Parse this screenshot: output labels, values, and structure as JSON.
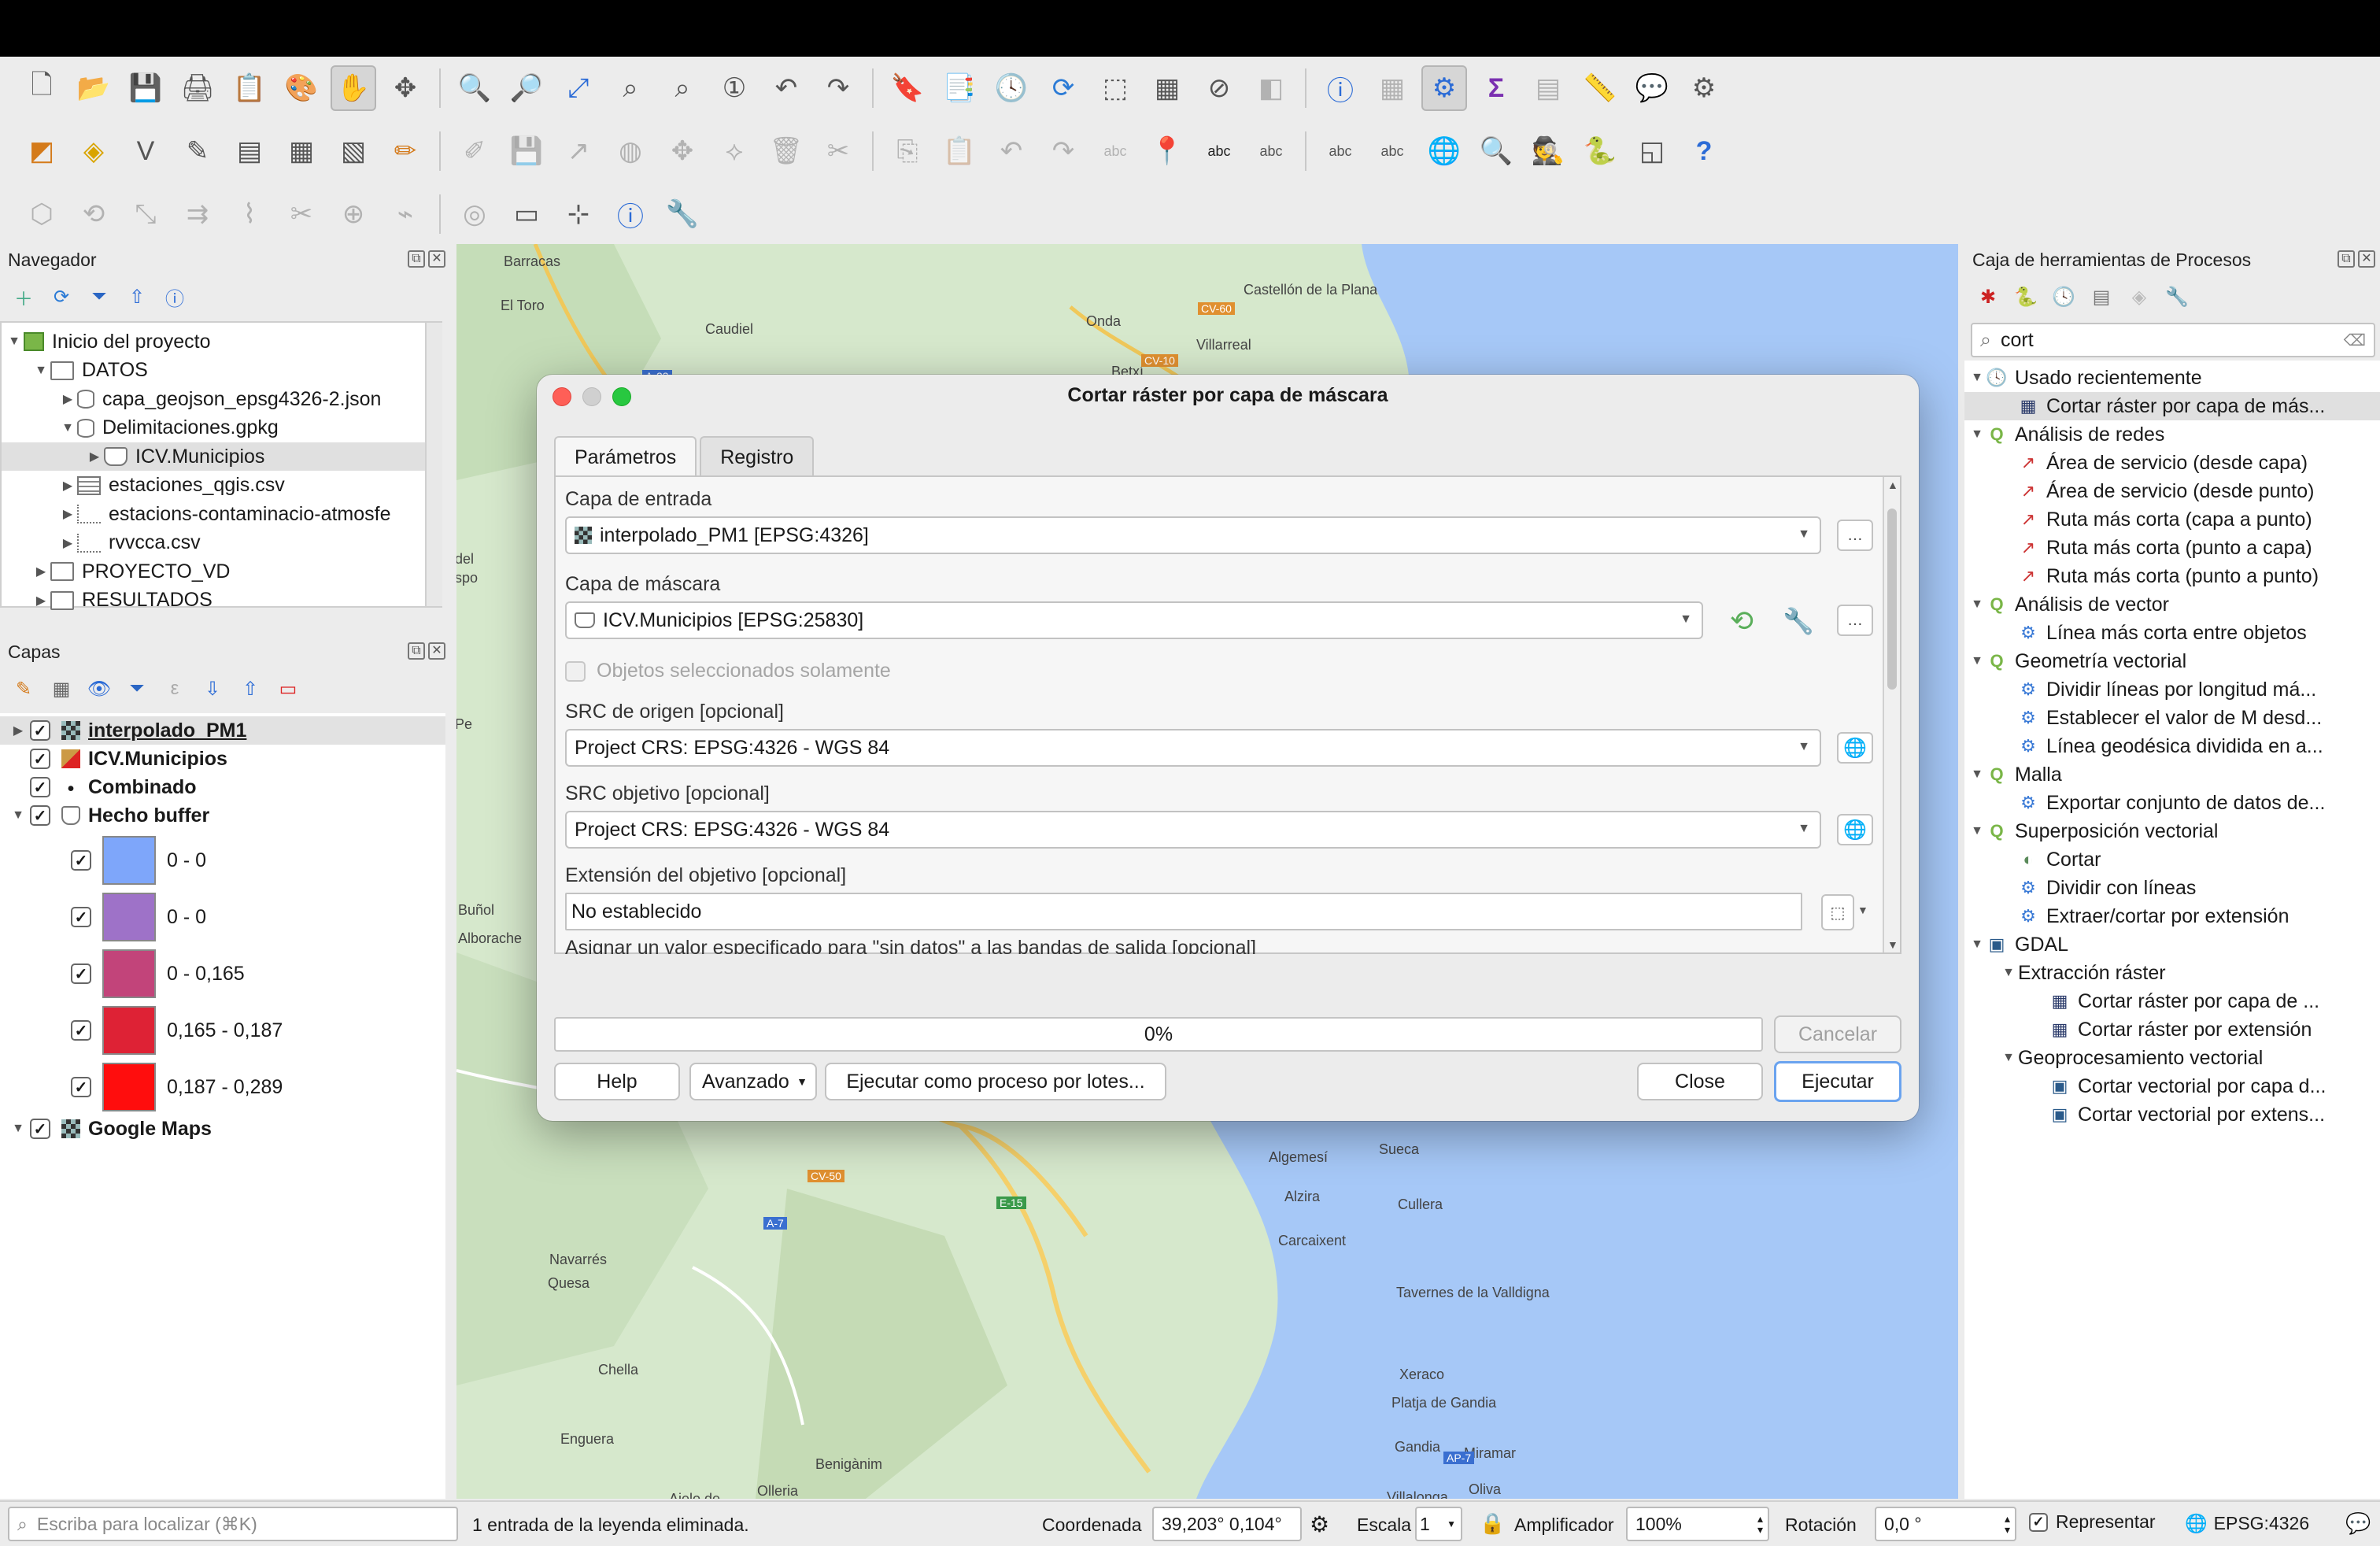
{
  "toolbar_icons": {
    "row1": [
      "new-project",
      "open-project",
      "save-project",
      "new-print-layout",
      "layout-manager",
      "style-manager",
      "pan",
      "pan-to-selection",
      "zoom-in",
      "zoom-out",
      "zoom-full",
      "zoom-to-selection",
      "zoom-to-layer",
      "zoom-native",
      "zoom-last",
      "zoom-next",
      "new-bookmark",
      "show-bookmarks",
      "temporal-controller",
      "refresh",
      "select-features",
      "open-table",
      "deselect",
      "select-by-location",
      "identify",
      "measure-grid",
      "processing-gear",
      "sum",
      "attribute-table",
      "measure-line",
      "annotation",
      "settings"
    ],
    "row2": [
      "data-source-manager",
      "new-geopackage",
      "new-shapefile",
      "new-temp-scratch",
      "add-vector",
      "add-raster",
      "add-mesh",
      "digitize-edit",
      "pencil",
      "save-edits",
      "digitize-line",
      "add-feature",
      "move-feature",
      "vertex-tool",
      "delete-selected",
      "cut",
      "copy",
      "paste",
      "undo",
      "redo",
      "label-abc",
      "label-pin",
      "label-highlight",
      "label-move",
      "label-rotate",
      "label-change",
      "plugin-globe",
      "plugin-magnifier",
      "plugin-spy",
      "python",
      "3d-view",
      "help"
    ],
    "row3": [
      "digitize-advanced",
      "rotate",
      "scale",
      "offset",
      "reshape",
      "split",
      "merge",
      "simplify",
      "fill-ring",
      "text-box",
      "snap",
      "identify-info",
      "wrench"
    ]
  },
  "navigator": {
    "title": "Navegador",
    "items": [
      {
        "label": "Inicio del proyecto",
        "level": 0,
        "type": "project",
        "expanded": true
      },
      {
        "label": "DATOS",
        "level": 1,
        "type": "folder",
        "expanded": true
      },
      {
        "label": "capa_geojson_epsg4326-2.json",
        "level": 2,
        "type": "db",
        "expanded": false
      },
      {
        "label": "Delimitaciones.gpkg",
        "level": 2,
        "type": "db",
        "expanded": true
      },
      {
        "label": "ICV.Municipios",
        "level": 3,
        "type": "polygon",
        "expanded": false
      },
      {
        "label": "estaciones_qgis.csv",
        "level": 2,
        "type": "csv",
        "expanded": false
      },
      {
        "label": "estacions-contaminacio-atmosfe",
        "level": 2,
        "type": "csvpoint",
        "expanded": false
      },
      {
        "label": "rvvcca.csv",
        "level": 2,
        "type": "csvpoint",
        "expanded": false
      },
      {
        "label": "PROYECTO_VD",
        "level": 1,
        "type": "folder",
        "expanded": false
      },
      {
        "label": "RESULTADOS",
        "level": 1,
        "type": "folder",
        "expanded": false
      }
    ]
  },
  "layers": {
    "title": "Capas",
    "items": [
      {
        "label": "interpolado_PM1",
        "checked": true,
        "selected": true,
        "underline": true
      },
      {
        "label": "ICV.Municipios",
        "checked": true
      },
      {
        "label": "Combinado",
        "checked": true
      },
      {
        "label": "Hecho buffer",
        "checked": true
      }
    ],
    "legend": [
      {
        "label": "0 - 0",
        "color": "#7ea6fa"
      },
      {
        "label": "0 - 0",
        "color": "#9e72c8"
      },
      {
        "label": "0 - 0,165",
        "color": "#c2447a"
      },
      {
        "label": "0,165 - 0,187",
        "color": "#de2235"
      },
      {
        "label": "0,187 - 0,289",
        "color": "#ff0d0d"
      }
    ],
    "google": "Google Maps"
  },
  "map_labels": [
    "Barracas",
    "El Toro",
    "Castellón de la Plana",
    "Onda",
    "Caudiel",
    "Villarreal",
    "Betxí",
    "A-23",
    "CV-10",
    "Buñol",
    "Alborache",
    "Algemesí",
    "Sueca",
    "Alzira",
    "Cullera",
    "Carcaixent",
    "Navarrés",
    "Quesa",
    "Tavernes de la Valldigna",
    "Chella",
    "Xeraco",
    "Platja de Gandia",
    "Enguera",
    "Gandia",
    "Miramar",
    "Benigànim",
    "Olleria",
    "Oliva",
    "Villalonga",
    "Aielo de",
    "A-7",
    "E-15",
    "AP-7",
    "CV-50",
    "CV-60",
    "Pe",
    "del",
    "spo"
  ],
  "dialog": {
    "title": "Cortar ráster por capa de máscara",
    "tab_params": "Parámetros",
    "tab_log": "Registro",
    "input_label": "Capa de entrada",
    "input_value": "interpolado_PM1 [EPSG:4326]",
    "mask_label": "Capa de máscara",
    "mask_value": "ICV.Municipios [EPSG:25830]",
    "selected_only": "Objetos seleccionados solamente",
    "src_origin_label": "SRC de origen [opcional]",
    "src_origin_value": "Project CRS: EPSG:4326 - WGS 84",
    "src_target_label": "SRC objetivo [opcional]",
    "src_target_value": "Project CRS: EPSG:4326 - WGS 84",
    "extent_label": "Extensión del objetivo [opcional]",
    "extent_value": "No establecido",
    "nodata_label": "Asignar un valor especificado para \"sin datos\" a las bandas de salida [opcional]",
    "progress": "0%",
    "progress_value": 0,
    "cancel": "Cancelar",
    "help": "Help",
    "advanced": "Avanzado",
    "batch": "Ejecutar como proceso por lotes...",
    "close": "Close",
    "run": "Ejecutar",
    "ellipsis": "…"
  },
  "toolbox": {
    "title": "Caja de herramientas de Procesos",
    "search_value": "cort",
    "items": [
      {
        "label": "Usado recientemente",
        "level": 0,
        "icon": "clock",
        "arrow": "down"
      },
      {
        "label": "Cortar ráster por capa de más...",
        "level": 1,
        "icon": "raster",
        "selected": true
      },
      {
        "label": "Análisis de redes",
        "level": 0,
        "icon": "qgis",
        "arrow": "down"
      },
      {
        "label": "Área de servicio (desde capa)",
        "level": 1,
        "icon": "network"
      },
      {
        "label": "Área de servicio (desde punto)",
        "level": 1,
        "icon": "network"
      },
      {
        "label": "Ruta más corta (capa a punto)",
        "level": 1,
        "icon": "network"
      },
      {
        "label": "Ruta más corta (punto a capa)",
        "level": 1,
        "icon": "network"
      },
      {
        "label": "Ruta más corta (punto a punto)",
        "level": 1,
        "icon": "network"
      },
      {
        "label": "Análisis de vector",
        "level": 0,
        "icon": "qgis",
        "arrow": "down"
      },
      {
        "label": "Línea más corta entre objetos",
        "level": 1,
        "icon": "gear"
      },
      {
        "label": "Geometría vectorial",
        "level": 0,
        "icon": "qgis",
        "arrow": "down"
      },
      {
        "label": "Dividir líneas por longitud má...",
        "level": 1,
        "icon": "gear"
      },
      {
        "label": "Establecer el valor de M desd...",
        "level": 1,
        "icon": "gear"
      },
      {
        "label": "Línea geodésica dividida en a...",
        "level": 1,
        "icon": "gear"
      },
      {
        "label": "Malla",
        "level": 0,
        "icon": "qgis",
        "arrow": "down"
      },
      {
        "label": "Exportar conjunto de datos de...",
        "level": 1,
        "icon": "gear"
      },
      {
        "label": "Superposición vectorial",
        "level": 0,
        "icon": "qgis",
        "arrow": "down"
      },
      {
        "label": "Cortar",
        "level": 1,
        "icon": "clip"
      },
      {
        "label": "Dividir con líneas",
        "level": 1,
        "icon": "gear"
      },
      {
        "label": "Extraer/cortar por extensión",
        "level": 1,
        "icon": "gear"
      },
      {
        "label": "GDAL",
        "level": 0,
        "icon": "gdal",
        "arrow": "down"
      },
      {
        "label": "Extracción ráster",
        "level": 1,
        "icon": "none",
        "arrow": "down"
      },
      {
        "label": "Cortar ráster por capa de ...",
        "level": 2,
        "icon": "raster"
      },
      {
        "label": "Cortar ráster por extensión",
        "level": 2,
        "icon": "raster"
      },
      {
        "label": "Geoprocesamiento vectorial",
        "level": 1,
        "icon": "none",
        "arrow": "down"
      },
      {
        "label": "Cortar vectorial por capa d...",
        "level": 2,
        "icon": "gdal"
      },
      {
        "label": "Cortar vectorial por extens...",
        "level": 2,
        "icon": "gdal"
      }
    ]
  },
  "statusbar": {
    "locator_placeholder": "Escriba para localizar (⌘K)",
    "message": "1 entrada de la leyenda eliminada.",
    "coord_label": "Coordenada",
    "coord_value": "39,203° 0,104°",
    "scale_label": "Escala",
    "scale_value": "1",
    "magnifier_label": "Amplificador",
    "magnifier_value": "100%",
    "rotation_label": "Rotación",
    "rotation_value": "0,0 °",
    "render_label": "Representar",
    "crs": "EPSG:4326"
  },
  "colors": {
    "sea": "#a6c8f7",
    "land": "#d6e8cc",
    "accent": "#6aa3ef",
    "qgis_green": "#7ab648"
  }
}
